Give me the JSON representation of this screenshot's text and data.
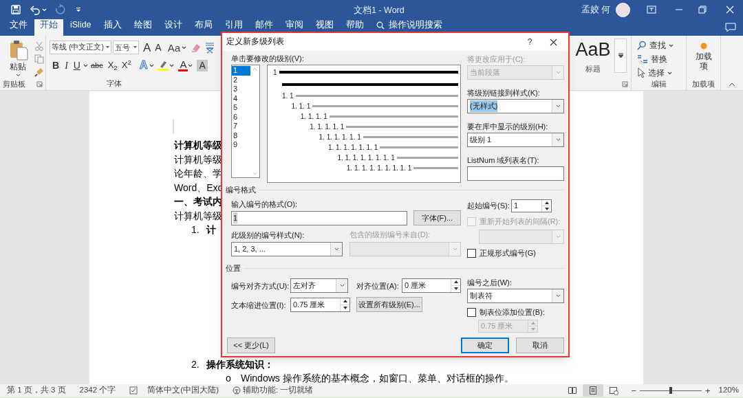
{
  "window": {
    "title": "文档1 - Word",
    "user": "孟姣 何"
  },
  "quick_access": [
    {
      "kind": "save",
      "disabled": false
    },
    {
      "kind": "undo",
      "disabled": false
    },
    {
      "kind": "redo",
      "disabled": true
    },
    {
      "kind": "customize",
      "disabled": false
    }
  ],
  "ribbon_tabs": [
    {
      "label": "文件",
      "selected": false
    },
    {
      "label": "开始",
      "selected": true
    },
    {
      "label": "iSlide",
      "selected": false
    },
    {
      "label": "插入",
      "selected": false
    },
    {
      "label": "绘图",
      "selected": false
    },
    {
      "label": "设计",
      "selected": false
    },
    {
      "label": "布局",
      "selected": false
    },
    {
      "label": "引用",
      "selected": false
    },
    {
      "label": "邮件",
      "selected": false
    },
    {
      "label": "审阅",
      "selected": false
    },
    {
      "label": "视图",
      "selected": false
    },
    {
      "label": "帮助",
      "selected": false
    }
  ],
  "tell_me": "操作说明搜索",
  "ribbon": {
    "clipboard": {
      "paste": "粘贴",
      "label": "剪贴板"
    },
    "font": {
      "font_name": "等线 (中文正文)",
      "font_size": "五号",
      "label": "字体",
      "tools": [
        {
          "kind": "grow",
          "glyph": "A"
        },
        {
          "kind": "shrink",
          "glyph": "A"
        },
        {
          "kind": "case",
          "glyph": "Aa"
        },
        {
          "kind": "clear"
        },
        {
          "kind": "phonetic"
        }
      ],
      "format_tools": [
        {
          "kind": "bold",
          "glyph": "B"
        },
        {
          "kind": "italic",
          "glyph": "I"
        },
        {
          "kind": "underline",
          "glyph": "U"
        },
        {
          "kind": "strike",
          "glyph": "abc"
        },
        {
          "kind": "sub",
          "glyph": "X$_{2}$"
        },
        {
          "kind": "sup",
          "glyph": "X$^{2}$"
        },
        {
          "kind": "effects",
          "glyph": "A"
        },
        {
          "kind": "highlight"
        },
        {
          "kind": "color",
          "glyph": "A"
        },
        {
          "kind": "shading",
          "glyph": "A"
        }
      ]
    },
    "styles": {
      "sample": "AaB",
      "name": "标题"
    },
    "editing": {
      "items": [
        {
          "kind": "find",
          "label": "查找"
        },
        {
          "kind": "replace",
          "label": "替换"
        },
        {
          "kind": "select",
          "label": "选择"
        }
      ],
      "label": "编辑"
    },
    "addins": {
      "button": "加载项",
      "label": "加载项"
    }
  },
  "document": {
    "top": [
      {
        "kind": "heading",
        "text": "计算机等级"
      },
      {
        "kind": "body",
        "text": "计算机等级"
      },
      {
        "kind": "body",
        "text": "论年龄、学"
      },
      {
        "kind": "body",
        "text": "Word、Exc"
      },
      {
        "kind": "heading",
        "text": "一、考试内"
      },
      {
        "kind": "body",
        "text": "计算机等级"
      },
      {
        "kind": "numbered",
        "number": "1.",
        "text": "计"
      }
    ],
    "bottom": [
      {
        "kind": "numbered",
        "number": "2.",
        "text": "操作系统知识："
      },
      {
        "kind": "bullet",
        "marker": "o",
        "text": "Windows 操作系统的基本概念，如窗口、菜单、对话框的操作。"
      }
    ]
  },
  "dialog": {
    "title": "定义新多级列表",
    "help": "?",
    "level_list": {
      "label": "单击要修改的级别(V):",
      "items": [
        {
          "label": "1",
          "selected": true
        },
        {
          "label": "2",
          "selected": false
        },
        {
          "label": "3",
          "selected": false
        },
        {
          "label": "4",
          "selected": false
        },
        {
          "label": "5",
          "selected": false
        },
        {
          "label": "6",
          "selected": false
        },
        {
          "label": "7",
          "selected": false
        },
        {
          "label": "8",
          "selected": false
        },
        {
          "label": "9",
          "selected": false
        }
      ]
    },
    "preview": [
      {
        "number": "1",
        "selected": true
      },
      {
        "number": "1. 1",
        "selected": false
      },
      {
        "number": "1. 1. 1",
        "selected": false
      },
      {
        "number": "1. 1. 1. 1",
        "selected": false
      },
      {
        "number": "1. 1. 1. 1. 1",
        "selected": false
      },
      {
        "number": "1. 1. 1. 1. 1. 1",
        "selected": false
      },
      {
        "number": "1. 1. 1. 1. 1. 1. 1",
        "selected": false
      },
      {
        "number": "1. 1. 1. 1. 1. 1. 1. 1",
        "selected": false
      },
      {
        "number": "1. 1. 1. 1. 1. 1. 1. 1. 1",
        "selected": false
      }
    ],
    "apply_to": {
      "label": "将更改应用于(C):",
      "value": "当前段落",
      "disabled": true
    },
    "link_style": {
      "label": "将级别链接到样式(K):",
      "value": "(无样式)",
      "selected": true
    },
    "gallery_level": {
      "label": "要在库中显示的级别(H):",
      "value": "级别 1"
    },
    "listnum": {
      "label": "ListNum 域列表名(T):"
    },
    "format_section": "编号格式",
    "format_input": {
      "label": "输入编号的格式(O):",
      "value": "1",
      "selected": true
    },
    "font_button": "字体(F)...",
    "start_at": {
      "label": "起始编号(S):",
      "value": "1"
    },
    "restart": {
      "label": "重新开始列表的间隔(R):",
      "checked": false,
      "disabled": true
    },
    "number_style": {
      "label": "此级别的编号样式(N):",
      "value": "1, 2, 3, ..."
    },
    "include_level": {
      "label": "包含的级别编号来自(D):",
      "disabled": true
    },
    "legal": {
      "label": "正规形式编号(G)",
      "checked": false
    },
    "position_section": "位置",
    "alignment": {
      "label": "编号对齐方式(U):",
      "value": "左对齐"
    },
    "aligned_at": {
      "label": "对齐位置(A):",
      "value": "0 厘米"
    },
    "indent": {
      "label": "文本缩进位置(I):",
      "value": "0.75 厘米"
    },
    "set_all": "设置所有级别(E)...",
    "follow": {
      "label": "编号之后(W):",
      "value": "制表符"
    },
    "tab_stop": {
      "label": "制表位添加位置(B):",
      "checked": false,
      "value": "0.75 厘米",
      "disabled": true
    },
    "buttons": [
      {
        "label": "<< 更少(L)",
        "default": false
      },
      {
        "label": "确定",
        "default": true
      },
      {
        "label": "取消",
        "default": false
      }
    ]
  },
  "status": {
    "items": [
      {
        "kind": "text",
        "text": "第 1 页，共 3 页"
      },
      {
        "kind": "text",
        "text": "2342 个字"
      },
      {
        "kind": "proofing"
      },
      {
        "kind": "text",
        "text": "简体中文(中国大陆)"
      },
      {
        "kind": "accessibility",
        "text": "辅助功能: 一切就绪"
      }
    ],
    "views": [
      {
        "kind": "read",
        "selected": false
      },
      {
        "kind": "print",
        "selected": true
      },
      {
        "kind": "web",
        "selected": false
      }
    ],
    "zoom_out": "−",
    "zoom_in": "+",
    "zoom": {
      "level": 0.5
    },
    "zoom_text": "120%"
  }
}
